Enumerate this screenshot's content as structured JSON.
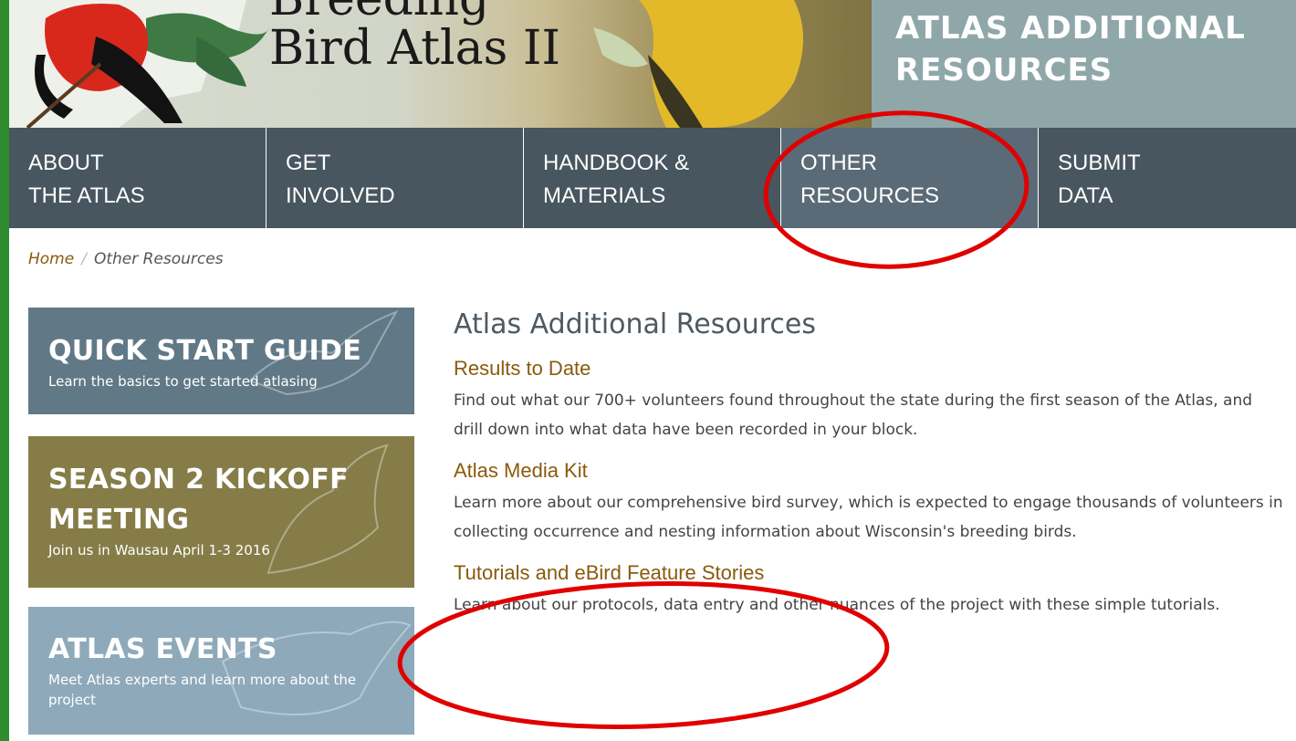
{
  "banner": {
    "logo_title_line1": "Breeding",
    "logo_title_line2": "Bird Atlas II",
    "page_title_line1": "ATLAS ADDITIONAL",
    "page_title_line2": "RESOURCES"
  },
  "nav": {
    "items": [
      {
        "line1": "ABOUT",
        "line2": "THE ATLAS"
      },
      {
        "line1": "GET",
        "line2": "INVOLVED"
      },
      {
        "line1": "HANDBOOK &",
        "line2": "MATERIALS"
      },
      {
        "line1": "OTHER",
        "line2": "RESOURCES"
      },
      {
        "line1": "SUBMIT",
        "line2": "DATA"
      }
    ]
  },
  "breadcrumb": {
    "home": "Home",
    "separator": "/",
    "current": "Other Resources"
  },
  "sidebar": {
    "cards": [
      {
        "title": "QUICK START GUIDE",
        "subtitle": "Learn the basics to get started atlasing"
      },
      {
        "title_line1": "SEASON 2 KICKOFF",
        "title_line2": "MEETING",
        "subtitle": "Join us in Wausau April 1-3 2016"
      },
      {
        "title": "ATLAS EVENTS",
        "subtitle_line1": "Meet Atlas experts and learn more about the",
        "subtitle_line2": "project"
      }
    ]
  },
  "main": {
    "heading": "Atlas Additional Resources",
    "resources": [
      {
        "title": "Results to Date",
        "description": "Find out what our 700+ volunteers found throughout the state during the first season of the Atlas, and drill down into what data have been recorded in your block."
      },
      {
        "title": "Atlas Media Kit",
        "description": "Learn more about our comprehensive bird survey, which is expected to engage thousands of volunteers in collecting occurrence and nesting information about Wisconsin's breeding birds."
      },
      {
        "title": "Tutorials and eBird Feature Stories",
        "description": "Learn about our protocols, data entry and other nuances of the project with these simple tutorials."
      }
    ]
  },
  "colors": {
    "outer_frame": "#2e8b2e",
    "nav_bg": "#47565f",
    "nav_active": "#5a6b77",
    "link_brown": "#8a5a0b",
    "annotation_red": "#e00000"
  }
}
